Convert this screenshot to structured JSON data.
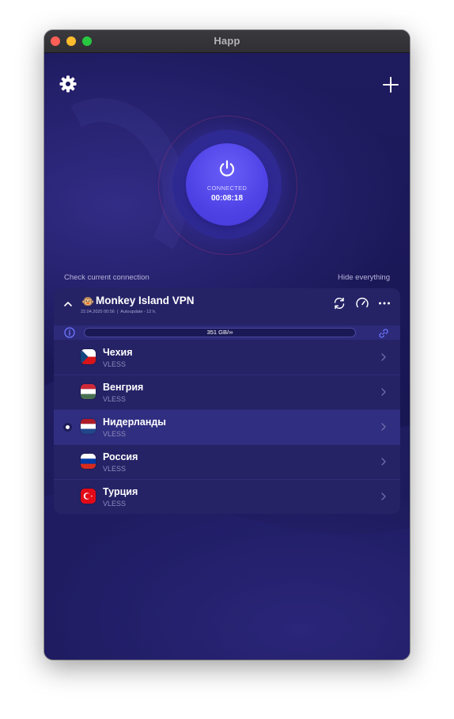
{
  "window": {
    "title": "Happ"
  },
  "toolbar": {
    "settings_icon": "gear-icon",
    "add_icon": "plus-icon"
  },
  "connection": {
    "status": "CONNECTED",
    "timer": "00:08:18",
    "power_icon": "power-icon"
  },
  "links": {
    "check": "Check current connection",
    "hide": "Hide everything"
  },
  "subscription": {
    "emoji": "🐵",
    "name": "Monkey Island VPN",
    "date": "22.04.2025 00:56",
    "autoupdate": "Autoupdate - 12 h.",
    "traffic": "351 GB/∞"
  },
  "servers": [
    {
      "name": "Чехия",
      "protocol": "VLESS",
      "flag": "czech-flag",
      "selected": false
    },
    {
      "name": "Венгрия",
      "protocol": "VLESS",
      "flag": "hungary-flag",
      "selected": false
    },
    {
      "name": "Нидерланды",
      "protocol": "VLESS",
      "flag": "netherlands-flag",
      "selected": true
    },
    {
      "name": "Россия",
      "protocol": "VLESS",
      "flag": "russia-flag",
      "selected": false
    },
    {
      "name": "Турция",
      "protocol": "VLESS",
      "flag": "turkey-flag",
      "selected": false
    }
  ],
  "colors": {
    "background": "#1a1756",
    "panel": "#252266",
    "accent": "#5a4ef0",
    "traffic_link": "#6d78ff"
  }
}
